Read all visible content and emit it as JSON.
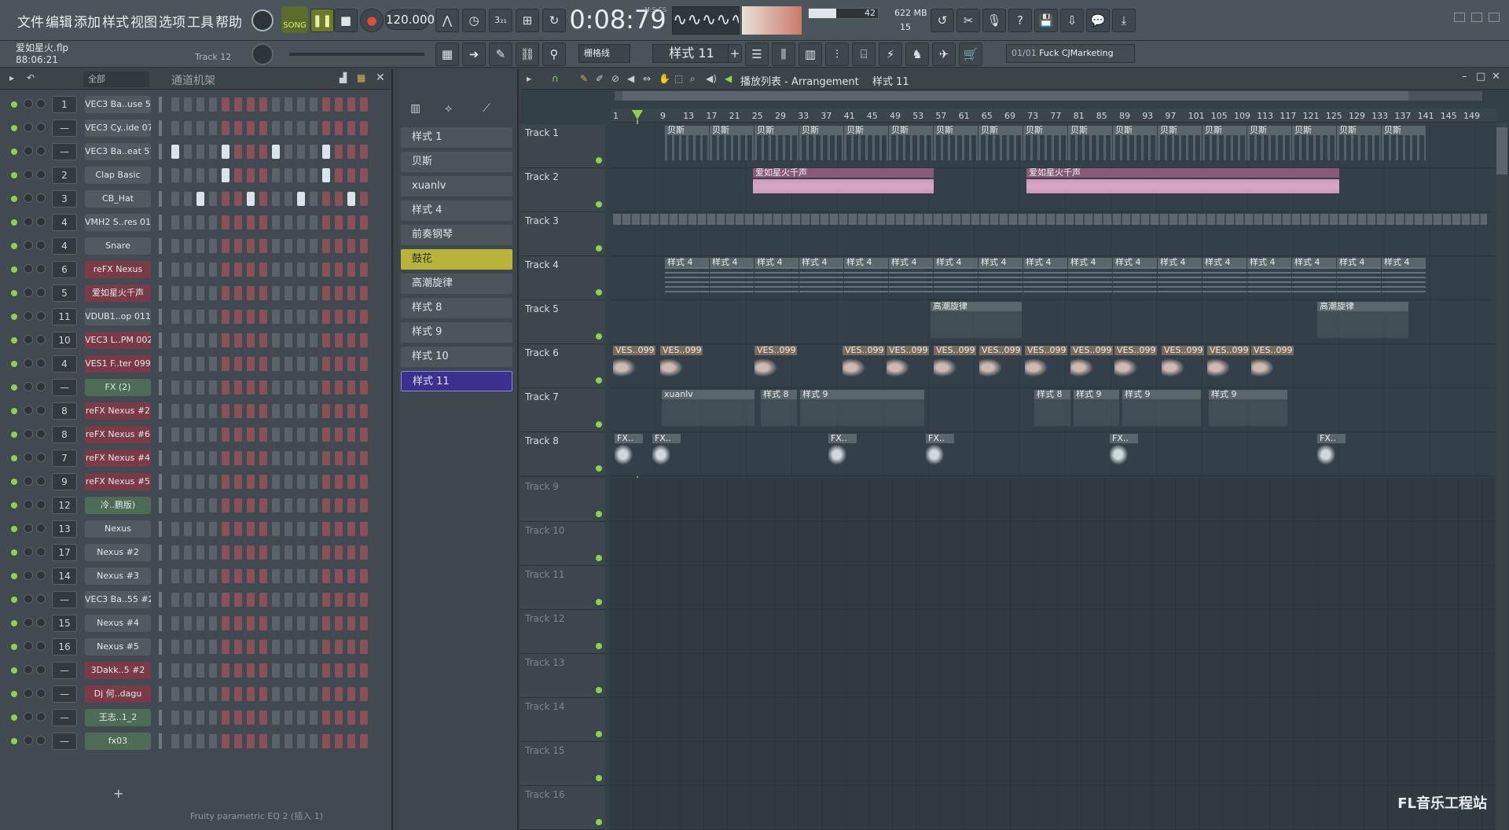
{
  "menu": [
    "文件",
    "编辑",
    "添加",
    "样式",
    "视图",
    "选项",
    "工具",
    "帮助"
  ],
  "transport": {
    "song_label": "SONG",
    "tempo": "120.000",
    "time": "0:08:79",
    "time_label": "M:S:CS",
    "cpu": "42",
    "ram": "622 MB",
    "poly": "15"
  },
  "project": {
    "filename": "爱如星火.flp",
    "position": "88:06:21",
    "hint": "Track 12"
  },
  "snap": "栅格线",
  "pattern_selector": "样式 11",
  "output": {
    "index": "01/01",
    "name": "Fuck CJMarketing"
  },
  "channel_rack": {
    "title": "通道机架",
    "filter": "全部",
    "add_label": "+",
    "footer": "Fruity parametric EQ 2 (插入 1)",
    "channels": [
      {
        "num": "1",
        "name": "VEC3 Ba..use 55",
        "color": "#505a60"
      },
      {
        "num": "—",
        "name": "VEC3 Cy..ide 07",
        "color": "#505a60"
      },
      {
        "num": "—",
        "name": "VEC3 Ba..eat 57",
        "color": "#505a60"
      },
      {
        "num": "2",
        "name": "Clap Basic",
        "color": "#505a60"
      },
      {
        "num": "3",
        "name": "CB_Hat",
        "color": "#505a60"
      },
      {
        "num": "4",
        "name": "VMH2 S..res 018",
        "color": "#505a60"
      },
      {
        "num": "4",
        "name": "Snare",
        "color": "#505a60"
      },
      {
        "num": "6",
        "name": "reFX Nexus",
        "color": "#7a3a48"
      },
      {
        "num": "5",
        "name": "爱如星火千声",
        "color": "#7a3a48"
      },
      {
        "num": "11",
        "name": "VDUB1..op 011",
        "color": "#505a60"
      },
      {
        "num": "10",
        "name": "VEC3 L..PM 002",
        "color": "#7a3a48"
      },
      {
        "num": "4",
        "name": "VES1 F..ter 099",
        "color": "#7a3a48"
      },
      {
        "num": "—",
        "name": "FX (2)",
        "color": "#4d6b55"
      },
      {
        "num": "8",
        "name": "reFX Nexus #2",
        "color": "#7a3a48"
      },
      {
        "num": "8",
        "name": "reFX Nexus #6",
        "color": "#7a3a48"
      },
      {
        "num": "7",
        "name": "reFX Nexus #4",
        "color": "#7a3a48"
      },
      {
        "num": "9",
        "name": "reFX Nexus #5",
        "color": "#7a3a48"
      },
      {
        "num": "12",
        "name": "冷..鹏版)",
        "color": "#4d6b55"
      },
      {
        "num": "13",
        "name": "Nexus",
        "color": "#505a60"
      },
      {
        "num": "17",
        "name": "Nexus #2",
        "color": "#505a60"
      },
      {
        "num": "14",
        "name": "Nexus #3",
        "color": "#505a60"
      },
      {
        "num": "—",
        "name": "VEC3 Ba..55 #2",
        "color": "#505a60"
      },
      {
        "num": "15",
        "name": "Nexus #4",
        "color": "#505a60"
      },
      {
        "num": "16",
        "name": "Nexus #5",
        "color": "#505a60"
      },
      {
        "num": "—",
        "name": "3Dakk..5 #2",
        "color": "#7a3a48"
      },
      {
        "num": "—",
        "name": "Dj 何..dagu",
        "color": "#7a3a48"
      },
      {
        "num": "—",
        "name": "王志..1_2",
        "color": "#4d6b55"
      },
      {
        "num": "—",
        "name": "fx03",
        "color": "#4d6b55"
      }
    ]
  },
  "patterns": [
    "样式 1",
    "贝斯",
    "xuanlv",
    "样式 4",
    "前奏钢琴",
    "鼓花",
    "高潮旋律",
    "样式 8",
    "样式 9",
    "样式 10",
    "样式 11"
  ],
  "playlist": {
    "title": "播放列表 - Arrangement",
    "current": "样式 11",
    "ruler": [
      "1",
      "9",
      "13",
      "17",
      "21",
      "25",
      "29",
      "33",
      "37",
      "41",
      "45",
      "49",
      "53",
      "57",
      "61",
      "65",
      "69",
      "73",
      "77",
      "81",
      "85",
      "89",
      "93",
      "97",
      "101",
      "105",
      "109",
      "113",
      "117",
      "121",
      "125",
      "129",
      "133",
      "137",
      "141",
      "145",
      "149"
    ],
    "tracks": [
      "Track 1",
      "Track 2",
      "Track 3",
      "Track 4",
      "Track 5",
      "Track 6",
      "Track 7",
      "Track 8",
      "Track 9",
      "Track 10",
      "Track 11",
      "Track 12",
      "Track 13",
      "Track 14",
      "Track 15",
      "Track 16"
    ],
    "clip_labels": {
      "t1": "贝斯",
      "t2": "爱如星火千声",
      "t4": "样式 4",
      "t5": "高潮旋律",
      "t6": "VES..099",
      "t7a": "xuanlv",
      "t7b": "样式 8",
      "t7c": "样式 9",
      "t8": "FX.."
    }
  },
  "watermark": "FL音乐工程站",
  "colors": {
    "accent_green": "#8fd14f",
    "selected_pattern": "#3c2f8f",
    "highlight_pattern": "#b8b43a"
  }
}
